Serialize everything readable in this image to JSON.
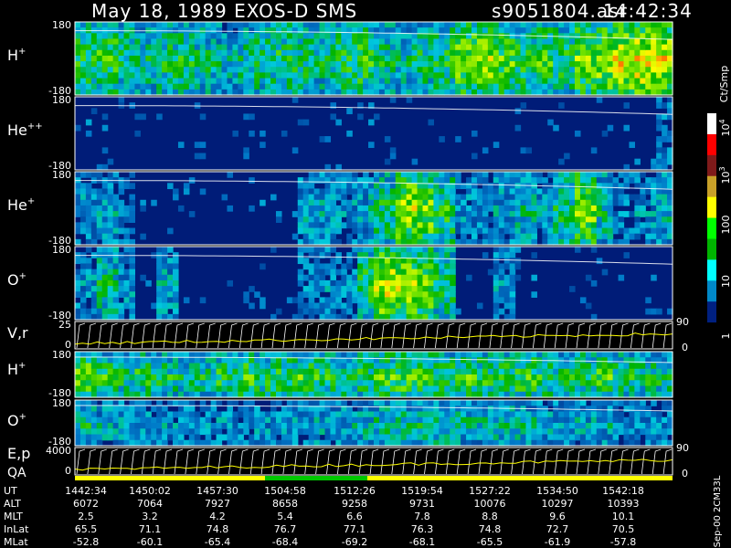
{
  "header": {
    "left_title": "May 18, 1989   EXOS-D SMS",
    "file_name": "s9051804.asr",
    "time": "14:42:34"
  },
  "panels": [
    {
      "id": "h-plus",
      "label_base": "H",
      "label_sup": "+",
      "y_top": "180",
      "y_bottom": "-180",
      "kind": "spectrogram"
    },
    {
      "id": "he-plusplus",
      "label_base": "He",
      "label_sup": "++",
      "y_top": "180",
      "y_bottom": "-180",
      "kind": "spectrogram"
    },
    {
      "id": "he-plus",
      "label_base": "He",
      "label_sup": "+",
      "y_top": "180",
      "y_bottom": "-180",
      "kind": "spectrogram"
    },
    {
      "id": "o-plus",
      "label_base": "O",
      "label_sup": "+",
      "y_top": "180",
      "y_bottom": "-180",
      "kind": "spectrogram"
    },
    {
      "id": "v-r",
      "label_base": "V,r",
      "label_sup": "",
      "y_top": "25",
      "y_bottom": "0",
      "right_top": "90",
      "right_bottom": "0",
      "kind": "traces"
    },
    {
      "id": "h-plus-2",
      "label_base": "H",
      "label_sup": "+",
      "y_top": "180",
      "y_bottom": "-180",
      "kind": "spectrogram"
    },
    {
      "id": "o-plus-2",
      "label_base": "O",
      "label_sup": "+",
      "y_top": "180",
      "y_bottom": "-180",
      "kind": "spectrogram"
    },
    {
      "id": "e-p",
      "label_base": "E,p",
      "label_sup": "",
      "y_top": "4000",
      "y_bottom": "0",
      "right_top": "90",
      "right_bottom": "0",
      "kind": "traces"
    }
  ],
  "qa_label": "QA",
  "colorbar": {
    "unit": "Ct/Smp",
    "ticks": [
      {
        "base": "10",
        "sup": "4"
      },
      {
        "base": "10",
        "sup": "3"
      },
      {
        "base": "100",
        "sup": ""
      },
      {
        "base": "10",
        "sup": ""
      },
      {
        "base": "1",
        "sup": ""
      }
    ],
    "colors": [
      "#ffffff",
      "#ff0000",
      "#7f1a1a",
      "#c8a028",
      "#ffff00",
      "#00ff00",
      "#00b400",
      "#00ffff",
      "#0088c8",
      "#002080",
      "#000000"
    ]
  },
  "table": {
    "rows": [
      {
        "label": "UT",
        "values": [
          "1442:34",
          "1450:02",
          "1457:30",
          "1504:58",
          "1512:26",
          "1519:54",
          "1527:22",
          "1534:50",
          "1542:18"
        ]
      },
      {
        "label": "ALT",
        "values": [
          "6072",
          "7064",
          "7927",
          "8658",
          "9258",
          "9731",
          "10076",
          "10297",
          "10393"
        ]
      },
      {
        "label": "MLT",
        "values": [
          "2.5",
          "3.2",
          "4.2",
          "5.4",
          "6.6",
          "7.8",
          "8.8",
          "9.6",
          "10.1"
        ]
      },
      {
        "label": "InLat",
        "values": [
          "65.5",
          "71.1",
          "74.8",
          "76.7",
          "77.1",
          "76.3",
          "74.8",
          "72.7",
          "70.5"
        ]
      },
      {
        "label": "MLat",
        "values": [
          "-52.8",
          "-60.1",
          "-65.4",
          "-68.4",
          "-69.2",
          "-68.1",
          "-65.5",
          "-61.9",
          "-57.8"
        ]
      }
    ]
  },
  "footer_vertical": "Sep-00  2CM33L",
  "chart_data": {
    "type": "heatmap",
    "title": "May 18, 1989   EXOS-D SMS",
    "x_ticks_ut": [
      "1442:34",
      "1450:02",
      "1457:30",
      "1504:58",
      "1512:26",
      "1519:54",
      "1527:22",
      "1534:50",
      "1542:18"
    ],
    "y_range_pitch_panels": [
      -180,
      180
    ],
    "y_range_vr": [
      0,
      25
    ],
    "y_range_ep": [
      0,
      4000
    ],
    "colorbar_range": [
      1,
      10000
    ],
    "colorbar_scale": "log",
    "colorbar_unit": "Ct/Smp",
    "series": [
      {
        "name": "H+",
        "intensity_profile": [
          0.55,
          0.6,
          0.5,
          0.45,
          0.5,
          0.55,
          0.45,
          0.4,
          0.45,
          0.5,
          0.55,
          0.5,
          0.45,
          0.55,
          0.6,
          0.5,
          0.45,
          0.5,
          0.55,
          0.7,
          0.75,
          0.65,
          0.55,
          0.6,
          0.55,
          0.7,
          0.75,
          0.8,
          0.85,
          0.8
        ]
      },
      {
        "name": "He++",
        "intensity_profile": [
          0.2,
          0.15,
          0.1,
          0.1,
          0.1,
          0.12,
          0.1,
          0.1,
          0.1,
          0.1,
          0.12,
          0.12,
          0.1,
          0.15,
          0.2,
          0.15,
          0.12,
          0.15,
          0.12,
          0.15,
          0.1,
          0.1,
          0.12,
          0.1,
          0.15,
          0.1,
          0.1,
          0.15,
          0.2,
          0.25
        ]
      },
      {
        "name": "He+",
        "intensity_profile": [
          0.3,
          0.35,
          0.25,
          0.2,
          0.2,
          0.2,
          0.15,
          0.15,
          0.15,
          0.2,
          0.2,
          0.35,
          0.35,
          0.3,
          0.35,
          0.5,
          0.75,
          0.7,
          0.55,
          0.3,
          0.25,
          0.35,
          0.4,
          0.3,
          0.5,
          0.7,
          0.45,
          0.25,
          0.3,
          0.4
        ]
      },
      {
        "name": "O+",
        "intensity_profile": [
          0.3,
          0.45,
          0.3,
          0.15,
          0.35,
          0.15,
          0.1,
          0.1,
          0.1,
          0.15,
          0.15,
          0.25,
          0.3,
          0.25,
          0.55,
          0.8,
          0.75,
          0.7,
          0.5,
          0.2,
          0.15,
          0.3,
          0.2,
          0.1,
          0.1,
          0.1,
          0.1,
          0.1,
          0.15,
          0.2
        ]
      },
      {
        "name": "H+ (2)",
        "intensity_profile": [
          0.7,
          0.55,
          0.5,
          0.55,
          0.5,
          0.45,
          0.5,
          0.55,
          0.6,
          0.55,
          0.55,
          0.6,
          0.55,
          0.5,
          0.55,
          0.6,
          0.65,
          0.6,
          0.55,
          0.6,
          0.55,
          0.55,
          0.6,
          0.55,
          0.5,
          0.55,
          0.6,
          0.55,
          0.5,
          0.5
        ]
      },
      {
        "name": "O+ (2)",
        "intensity_profile": [
          0.45,
          0.35,
          0.35,
          0.3,
          0.3,
          0.3,
          0.3,
          0.3,
          0.3,
          0.3,
          0.3,
          0.3,
          0.35,
          0.35,
          0.4,
          0.45,
          0.45,
          0.45,
          0.45,
          0.4,
          0.4,
          0.4,
          0.4,
          0.35,
          0.35,
          0.35,
          0.35,
          0.3,
          0.3,
          0.3
        ]
      }
    ]
  }
}
